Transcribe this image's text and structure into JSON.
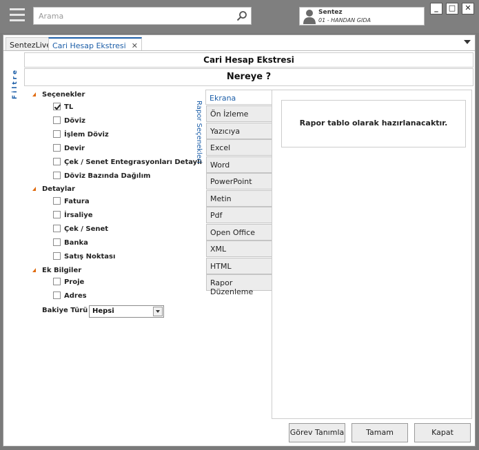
{
  "search": {
    "placeholder": "Arama"
  },
  "user": {
    "name": "Sentez",
    "company": "01 - HANDAN GIDA"
  },
  "window_buttons": {
    "minimize": "_",
    "maximize": "□",
    "close": "✕"
  },
  "tabs": [
    {
      "label": "SentezLive"
    },
    {
      "label": "Cari Hesap Ekstresi",
      "close": "✕"
    }
  ],
  "side_label": "Filtre",
  "header_title": "Cari Hesap Ekstresi",
  "header_subtitle": "Nereye ?",
  "groups": [
    {
      "label": "Seçenekler",
      "items": [
        {
          "label": "TL",
          "checked": true
        },
        {
          "label": "Döviz",
          "checked": false
        },
        {
          "label": "İşlem Döviz",
          "checked": false
        },
        {
          "label": "Devir",
          "checked": false
        },
        {
          "label": "Çek / Senet Entegrasyonları Detaylı",
          "checked": false
        },
        {
          "label": "Döviz Bazında Dağılım",
          "checked": false
        }
      ]
    },
    {
      "label": "Detaylar",
      "items": [
        {
          "label": "Fatura",
          "checked": false
        },
        {
          "label": "İrsaliye",
          "checked": false
        },
        {
          "label": "Çek / Senet",
          "checked": false
        },
        {
          "label": "Banka",
          "checked": false
        },
        {
          "label": "Satış Noktası",
          "checked": false
        }
      ]
    },
    {
      "label": "Ek Bilgiler",
      "items": [
        {
          "label": "Proje",
          "checked": false
        },
        {
          "label": "Adres",
          "checked": false
        }
      ]
    }
  ],
  "bakiye": {
    "label": "Bakiye Türü",
    "value": "Hepsi"
  },
  "report_options_label": "Rapor Seçenekleri",
  "output_selected": "Ekrana",
  "output_options": [
    "Ön İzleme",
    "Yazıcıya",
    "Excel",
    "Word",
    "PowerPoint",
    "Metin",
    "Pdf",
    "Open Office",
    "XML",
    "HTML",
    "Rapor Düzenleme"
  ],
  "info_text": "Rapor tablo olarak hazırlanacaktır.",
  "buttons": {
    "gorev": "Görev Tanımla",
    "tamam": "Tamam",
    "kapat": "Kapat"
  }
}
